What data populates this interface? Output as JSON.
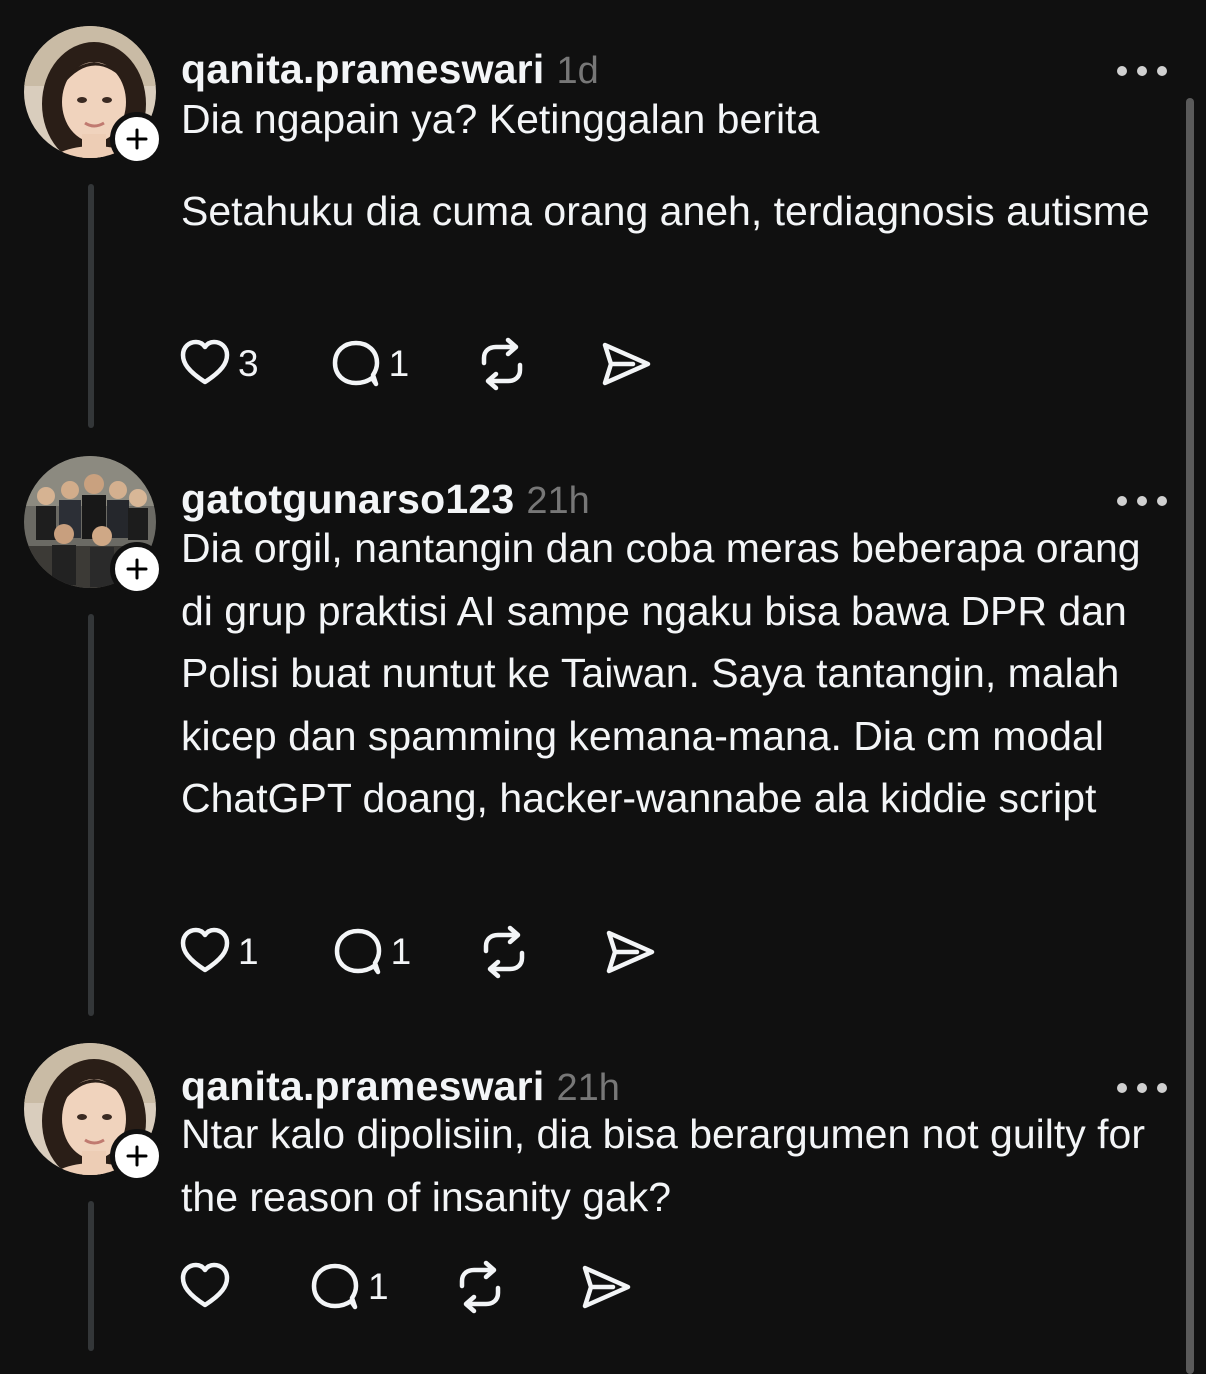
{
  "posts": [
    {
      "username": "qanita.prameswari",
      "time": "1d",
      "paragraphs": [
        "Dia ngapain ya? Ketinggalan berita",
        "Setahuku dia cuma orang aneh, terdiagnosis autisme"
      ],
      "likes": "3",
      "replies": "1",
      "avatar": "woman-portrait"
    },
    {
      "username": "gatotgunarso123",
      "time": "21h",
      "paragraphs": [
        "Dia orgil, nantangin dan coba meras beberapa orang di grup praktisi AI sampe ngaku bisa bawa DPR dan Polisi buat nuntut ke Taiwan. Saya tantangin, malah kicep dan spamming kemana-mana. Dia cm modal ChatGPT doang, hacker-wannabe ala kiddie script"
      ],
      "likes": "1",
      "replies": "1",
      "avatar": "group-photo"
    },
    {
      "username": "qanita.prameswari",
      "time": "21h",
      "paragraphs": [
        "Ntar kalo dipolisiin, dia bisa berargumen not guilty for the reason of insanity gak?"
      ],
      "likes": "",
      "replies": "1",
      "avatar": "woman-portrait"
    }
  ],
  "icons": {
    "like": "heart-icon",
    "reply": "comment-icon",
    "repost": "repost-icon",
    "share": "send-icon",
    "more": "more-dots-icon",
    "follow": "plus-icon"
  },
  "colors": {
    "background": "#101010",
    "text": "#f3f5f7",
    "secondary": "#777777",
    "thread_line": "#333638"
  }
}
